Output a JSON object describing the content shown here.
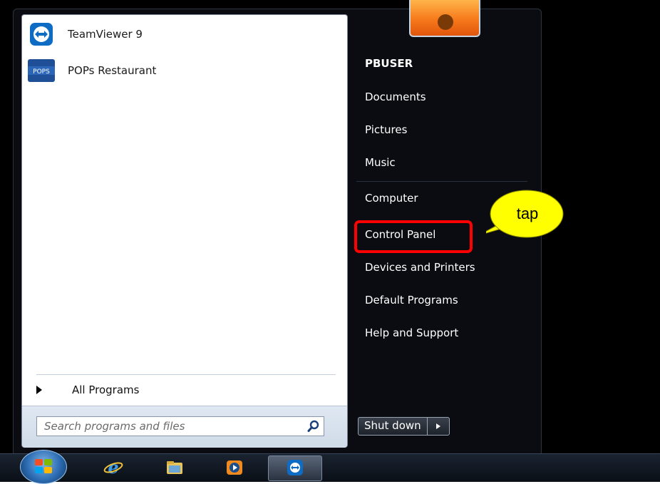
{
  "start_menu": {
    "pinned_programs": [
      {
        "label": "TeamViewer 9",
        "icon": "teamviewer-icon"
      },
      {
        "label": "POPs Restaurant",
        "icon": "pops-restaurant-icon",
        "icon_text": "POPS"
      }
    ],
    "all_programs_label": "All Programs",
    "search": {
      "placeholder": "Search programs and files",
      "value": ""
    }
  },
  "right_pane": {
    "user_picture_icon": "flower-user-icon",
    "items": [
      {
        "label": "PBUSER"
      },
      {
        "label": "Documents"
      },
      {
        "label": "Pictures"
      },
      {
        "label": "Music"
      },
      {
        "label": "Computer"
      },
      {
        "label": "Control Panel"
      },
      {
        "label": "Devices and Printers"
      },
      {
        "label": "Default Programs"
      },
      {
        "label": "Help and Support"
      }
    ],
    "shutdown_label": "Shut down"
  },
  "taskbar": {
    "start_button_icon": "windows-start-orb-icon",
    "pinned": [
      {
        "icon": "internet-explorer-icon"
      },
      {
        "icon": "file-explorer-icon"
      },
      {
        "icon": "media-player-icon"
      },
      {
        "icon": "teamviewer-icon"
      }
    ]
  },
  "annotation": {
    "callout_text": "tap",
    "highlight_color": "#ff0000",
    "callout_color": "#ffff00"
  }
}
